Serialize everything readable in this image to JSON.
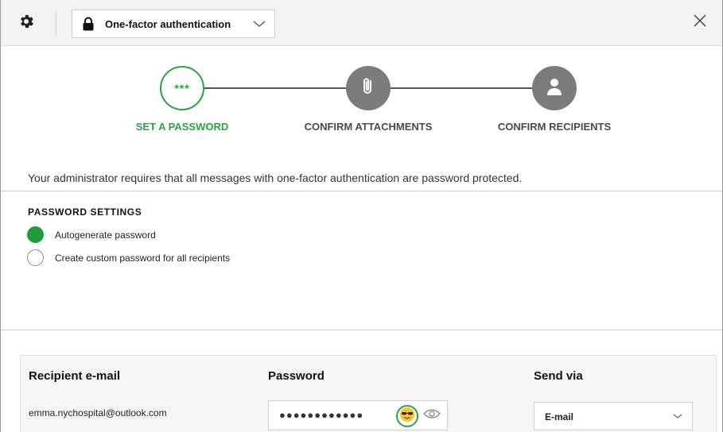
{
  "toolbar": {
    "auth_mode": "One-factor authentication",
    "icons": {
      "settings": "gear-icon",
      "lock": "lock-icon",
      "dropdown": "chevron-down-icon",
      "close": "close-icon"
    }
  },
  "stepper": {
    "steps": [
      {
        "label": "SET A PASSWORD",
        "state": "active",
        "symbol": "***"
      },
      {
        "label": "CONFIRM ATTACHMENTS",
        "state": "pending",
        "icon": "paperclip-icon"
      },
      {
        "label": "CONFIRM RECIPIENTS",
        "state": "pending",
        "icon": "person-icon"
      }
    ]
  },
  "notice": "Your administrator requires that all messages with one-factor authentication are password protected.",
  "password_settings": {
    "heading": "PASSWORD SETTINGS",
    "options": [
      {
        "label": "Autogenerate password",
        "selected": true
      },
      {
        "label": "Create custom password for all recipients",
        "selected": false
      }
    ]
  },
  "recipients": {
    "headers": {
      "email": "Recipient e-mail",
      "password": "Password",
      "send_via": "Send via"
    },
    "rows": [
      {
        "email": "emma.nychospital@outlook.com",
        "password_mask": "●●●●●●●●●●●●",
        "send_via": "E-mail"
      }
    ]
  },
  "colors": {
    "accent_green": "#2aa340",
    "step_inactive": "#7c7c7c",
    "toolbar_bg": "#f3f3f3"
  }
}
